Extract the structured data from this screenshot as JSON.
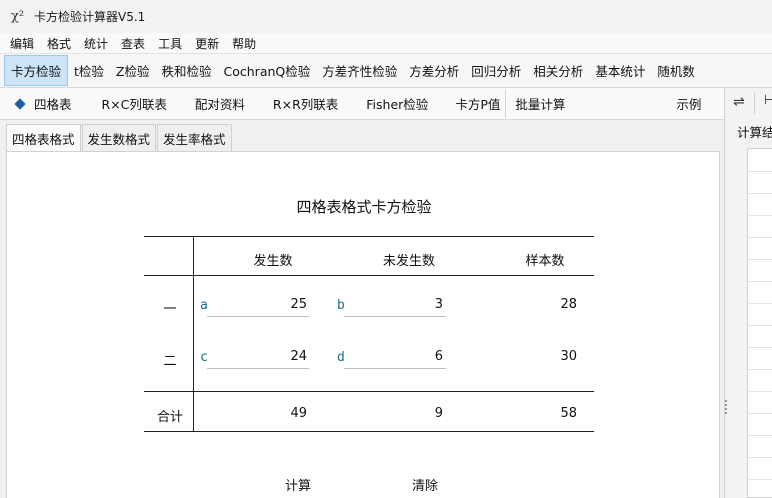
{
  "window": {
    "icon_text": "χ²",
    "title": "卡方检验计算器V5.1"
  },
  "menu": [
    "编辑",
    "格式",
    "统计",
    "查表",
    "工具",
    "更新",
    "帮助"
  ],
  "module_tabs": [
    {
      "label": "卡方检验",
      "active": true
    },
    {
      "label": "t检验",
      "active": false
    },
    {
      "label": "Z检验",
      "active": false
    },
    {
      "label": "秩和检验",
      "active": false
    },
    {
      "label": "CochranQ检验",
      "active": false
    },
    {
      "label": "方差齐性检验",
      "active": false
    },
    {
      "label": "方差分析",
      "active": false
    },
    {
      "label": "回归分析",
      "active": false
    },
    {
      "label": "相关分析",
      "active": false
    },
    {
      "label": "基本统计",
      "active": false
    },
    {
      "label": "随机数",
      "active": false
    }
  ],
  "sub_items": [
    {
      "label": "四格表",
      "selected": true
    },
    {
      "label": "R×C列联表",
      "selected": false
    },
    {
      "label": "配对资料",
      "selected": false
    },
    {
      "label": "R×R列联表",
      "selected": false
    },
    {
      "label": "Fisher检验",
      "selected": false
    },
    {
      "label": "卡方P值",
      "selected": false
    },
    {
      "label": "批量计算",
      "selected": false
    },
    {
      "label": "示例",
      "selected": false
    }
  ],
  "right_panel": {
    "swap_icon_glyph": "⇌",
    "label": "计算结果"
  },
  "format_tabs": [
    {
      "label": "四格表格式",
      "active": true
    },
    {
      "label": "发生数格式",
      "active": false
    },
    {
      "label": "发生率格式",
      "active": false
    }
  ],
  "table": {
    "title": "四格表格式卡方检验",
    "headers": [
      "发生数",
      "未发生数",
      "样本数"
    ],
    "rows": [
      {
        "label": "一",
        "a_letter": "a",
        "a_value": "25",
        "b_letter": "b",
        "b_value": "3",
        "total": "28"
      },
      {
        "label": "二",
        "a_letter": "c",
        "a_value": "24",
        "b_letter": "d",
        "b_value": "6",
        "total": "30"
      }
    ],
    "sum_row": {
      "label": "合计",
      "col1": "49",
      "col2": "9",
      "total": "58"
    }
  },
  "actions": {
    "calculate": "计算",
    "clear": "清除"
  }
}
